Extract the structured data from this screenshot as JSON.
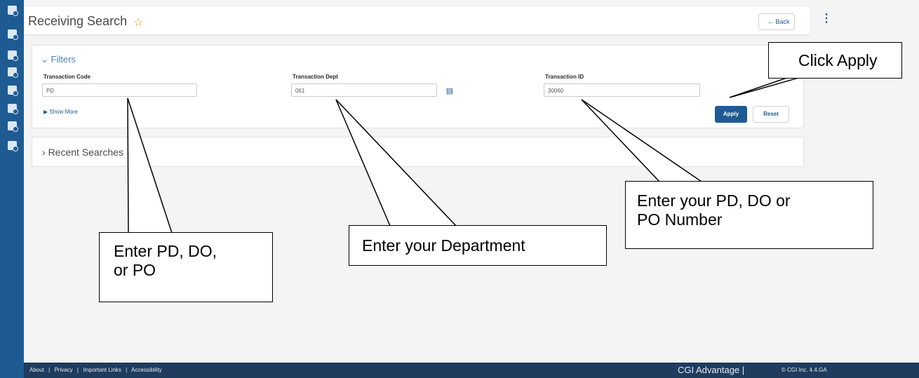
{
  "sidebar": {
    "icons": [
      "document-icon",
      "document-icon",
      "grid-document-icon",
      "document-icon",
      "document-edit-icon",
      "search-document-icon",
      "gear-group-icon",
      "report-icon"
    ]
  },
  "header": {
    "title": "Receiving Search",
    "back_label": "← Back"
  },
  "filters": {
    "title": "Filters",
    "fields": {
      "code": {
        "label": "Transaction Code",
        "value": "PD"
      },
      "dept": {
        "label": "Transaction Dept",
        "value": "061"
      },
      "id": {
        "label": "Transaction ID",
        "value": "30060"
      }
    },
    "show_more": "Show More",
    "apply_label": "Apply",
    "reset_label": "Reset"
  },
  "recent": {
    "title": "Recent Searches"
  },
  "footer": {
    "links": [
      "About",
      "|",
      "Privacy",
      "|",
      "Important Links",
      "|",
      "Accessibility"
    ],
    "brand": "CGI Advantage   |",
    "copyright": "© CGI Inc.   4.4.GA"
  },
  "annotations": {
    "apply": "Click Apply",
    "number": "Enter your PD, DO or\nPO Number",
    "dept": "Enter your Department",
    "code": "Enter PD, DO,\nor PO"
  },
  "colors": {
    "sidebar": "#1e5b93",
    "accent": "#1e5b93",
    "footer": "#1f3b5e",
    "star": "#e89b2c"
  }
}
